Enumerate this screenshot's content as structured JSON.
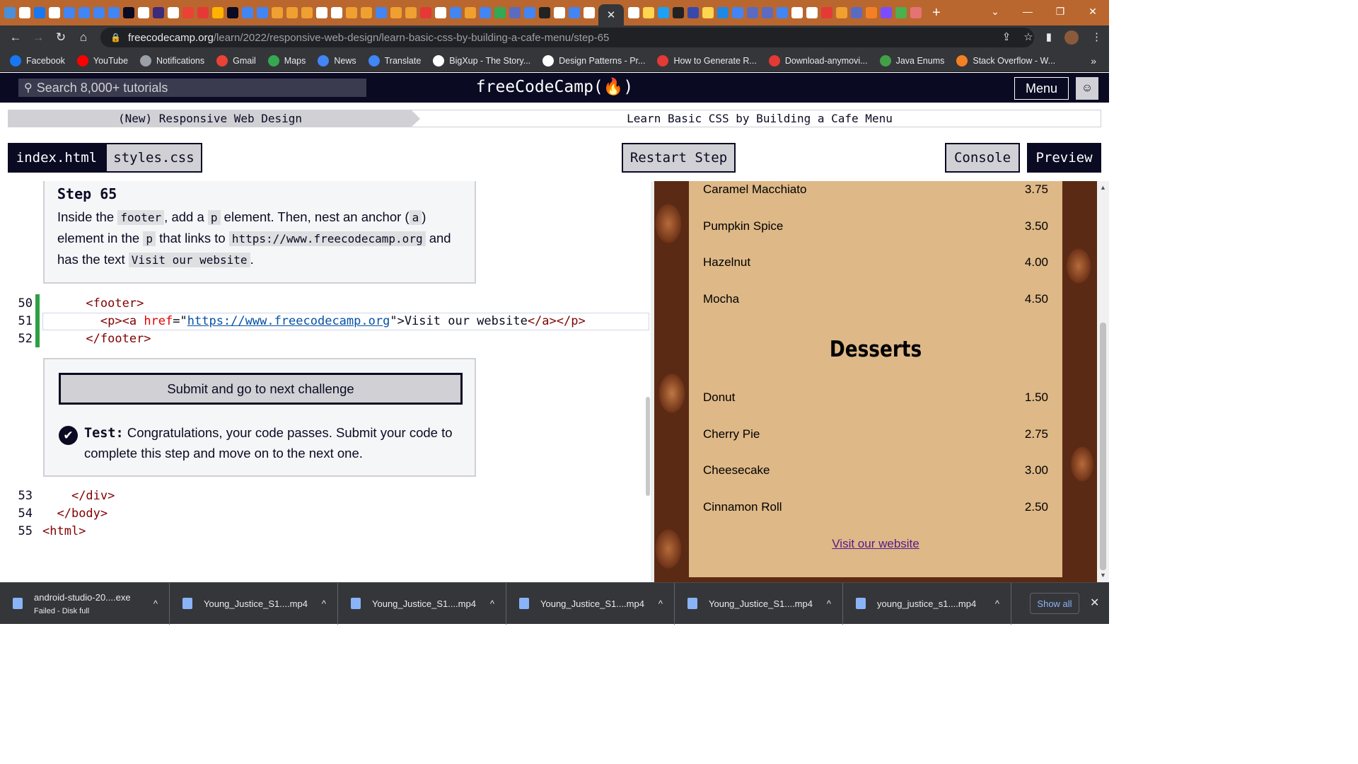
{
  "browser": {
    "url_host": "freecodecamp.org",
    "url_path": "/learn/2022/responsive-web-design/learn-basic-css-by-building-a-cafe-menu/step-65",
    "new_tab_label": "+",
    "bookmarks": [
      {
        "label": "Facebook",
        "color": "#1877f2"
      },
      {
        "label": "YouTube",
        "color": "#ff0000"
      },
      {
        "label": "Notifications",
        "color": "#9aa0a6"
      },
      {
        "label": "Gmail",
        "color": "#ea4335"
      },
      {
        "label": "Maps",
        "color": "#34a853"
      },
      {
        "label": "News",
        "color": "#4285f4"
      },
      {
        "label": "Translate",
        "color": "#4285f4"
      },
      {
        "label": "BigXup - The Story...",
        "color": "#ffffff"
      },
      {
        "label": "Design Patterns - Pr...",
        "color": "#ffffff"
      },
      {
        "label": "How to Generate R...",
        "color": "#e53935"
      },
      {
        "label": "Download-anymovi...",
        "color": "#e53935"
      },
      {
        "label": "Java Enums",
        "color": "#43a047"
      },
      {
        "label": "Stack Overflow - W...",
        "color": "#f48024"
      }
    ]
  },
  "fcc": {
    "search_placeholder": "Search 8,000+ tutorials",
    "logo": "freeCodeCamp(🔥)",
    "menu_label": "Menu"
  },
  "breadcrumb": {
    "course": "(New) Responsive Web Design",
    "project": "Learn Basic CSS by Building a Cafe Menu"
  },
  "toolbar": {
    "tab_index": "index.html",
    "tab_styles": "styles.css",
    "restart": "Restart Step",
    "console": "Console",
    "preview": "Preview"
  },
  "instructions": {
    "title": "Step 65",
    "t1": "Inside the ",
    "c1": "footer",
    "t2": ", add a ",
    "c2": "p",
    "t3": " element. Then, nest an anchor (",
    "c3": "a",
    "t4": ") element in the ",
    "c4": "p",
    "t5": " that links to ",
    "c5": "https://www.freecodecamp.org",
    "t6": " and has the text ",
    "c6": "Visit our website",
    "t7": "."
  },
  "code": {
    "l50_num": "50",
    "l51_num": "51",
    "l52_num": "52",
    "l53_num": "53",
    "l54_num": "54",
    "l55_num": "55",
    "l50_indent": "      ",
    "l50_tag": "<footer>",
    "l51_indent": "        ",
    "l51_open": "<p><a ",
    "l51_attr": "href",
    "l51_eq": "=\"",
    "l51_val": "https://www.freecodecamp.org",
    "l51_mid": "\">",
    "l51_text": "Visit our website",
    "l51_close": "</a></p>",
    "l52_indent": "      ",
    "l52_tag": "</footer>",
    "l53_indent": "    ",
    "l53_tag": "</div>",
    "l54_indent": "  ",
    "l54_tag": "</body>",
    "l55_indent": "",
    "l55_tag": "<html>"
  },
  "test": {
    "submit_label": "Submit and go to next challenge",
    "label": "Test:",
    "message": " Congratulations, your code passes. Submit your code to complete this step and move on to the next one."
  },
  "preview": {
    "coffee_items": [
      {
        "name": "Caramel Macchiato",
        "price": "3.75"
      },
      {
        "name": "Pumpkin Spice",
        "price": "3.50"
      },
      {
        "name": "Hazelnut",
        "price": "4.00"
      },
      {
        "name": "Mocha",
        "price": "4.50"
      }
    ],
    "desserts_heading": "Desserts",
    "dessert_items": [
      {
        "name": "Donut",
        "price": "1.50"
      },
      {
        "name": "Cherry Pie",
        "price": "2.75"
      },
      {
        "name": "Cheesecake",
        "price": "3.00"
      },
      {
        "name": "Cinnamon Roll",
        "price": "2.50"
      }
    ],
    "link_text": "Visit our website"
  },
  "downloads": {
    "items": [
      {
        "name": "android-studio-20....exe",
        "status": "Failed - Disk full"
      },
      {
        "name": "Young_Justice_S1....mp4",
        "status": ""
      },
      {
        "name": "Young_Justice_S1....mp4",
        "status": ""
      },
      {
        "name": "Young_Justice_S1....mp4",
        "status": ""
      },
      {
        "name": "Young_Justice_S1....mp4",
        "status": ""
      },
      {
        "name": "young_justice_s1....mp4",
        "status": ""
      }
    ],
    "show_all": "Show all"
  }
}
